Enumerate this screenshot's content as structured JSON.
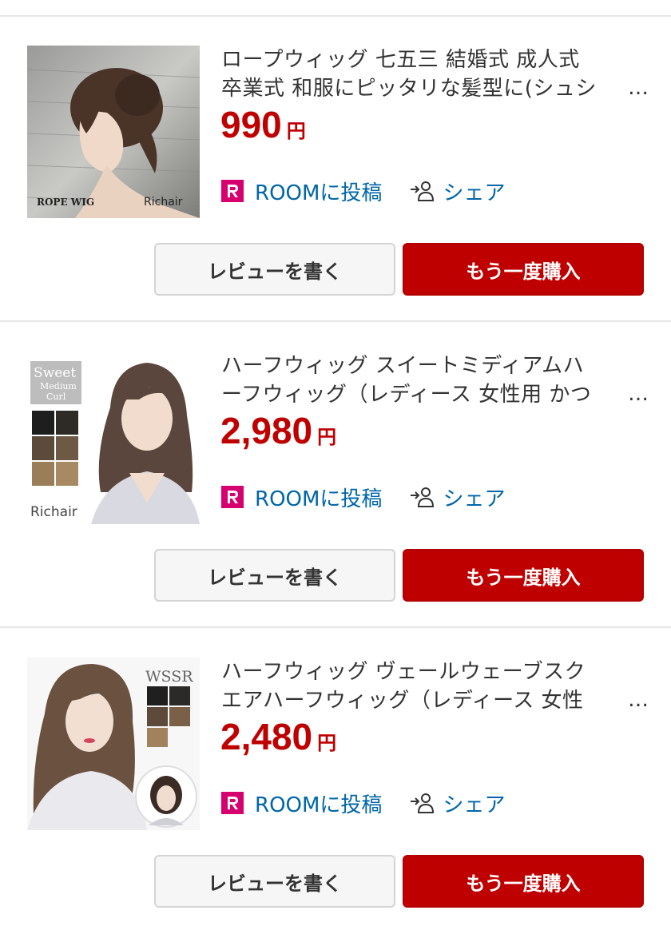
{
  "items": [
    {
      "image_alt": "ROPE WIG Richair",
      "image_text": [
        "ROPE WIG",
        "Richair"
      ],
      "title_lines": [
        "ロープウィッグ 七五三 結婚式 成人式",
        "卒業式 和服にピッタリな髪型に(シュシ"
      ],
      "ellipsis": "…",
      "price": "990",
      "currency": "円",
      "room_label": "ROOMに投稿",
      "share_label": "シェア",
      "review_button": "レビューを書く",
      "buy_button": "もう一度購入"
    },
    {
      "image_alt": "Sweet Medium Curl Richair",
      "image_text": [
        "Sweet",
        "Medium",
        "Curl",
        "Richair"
      ],
      "title_lines": [
        "ハーフウィッグ スイートミディアムハ",
        "ーフウィッグ（レディース 女性用 かつ"
      ],
      "ellipsis": "…",
      "price": "2,980",
      "currency": "円",
      "room_label": "ROOMに投稿",
      "share_label": "シェア",
      "review_button": "レビューを書く",
      "buy_button": "もう一度購入"
    },
    {
      "image_alt": "WSSR",
      "image_text": [
        "WSSR"
      ],
      "title_lines": [
        "ハーフウィッグ ヴェールウェーブスク",
        "エアハーフウィッグ（レディース 女性"
      ],
      "ellipsis": "…",
      "price": "2,480",
      "currency": "円",
      "room_label": "ROOMに投稿",
      "share_label": "シェア",
      "review_button": "レビューを書く",
      "buy_button": "もう一度購入"
    }
  ],
  "icons": {
    "room": "rakuten-room-icon",
    "share": "share-person-icon"
  },
  "colors": {
    "price": "#bf0000",
    "link": "#0066aa",
    "buy_button": "#bf0000",
    "room_badge": "#d6006f"
  }
}
